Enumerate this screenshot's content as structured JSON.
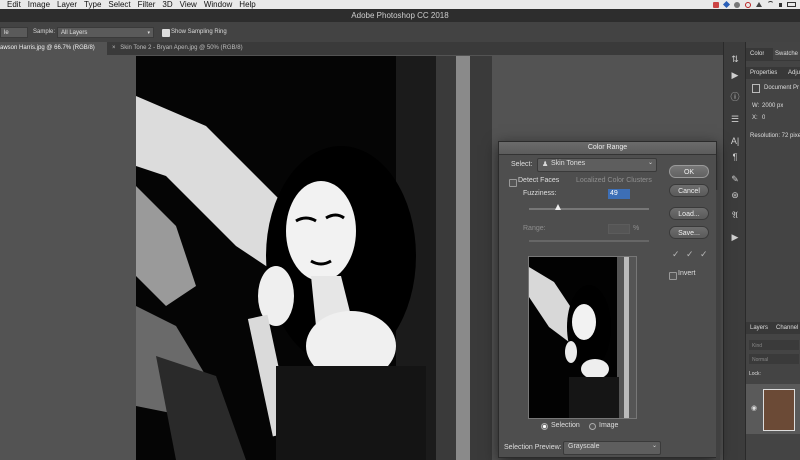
{
  "menubar": {
    "items": [
      "Edit",
      "Image",
      "Layer",
      "Type",
      "Select",
      "Filter",
      "3D",
      "View",
      "Window",
      "Help"
    ]
  },
  "titlebar": {
    "title": "Adobe Photoshop CC 2018"
  },
  "options": {
    "mode_value": "le",
    "sample_label": "Sample:",
    "sample_value": "All Layers",
    "sampling_ring_label": "Show Sampling Ring"
  },
  "tabs": [
    {
      "label": "awson Harris.jpg @ 66.7% (RGB/8)",
      "active": true
    },
    {
      "label": "Skin Tone 2 - Bryan Apen.jpg @ 50% (RGB/8)",
      "active": false
    }
  ],
  "right_panels": {
    "top_tabs": [
      "Color",
      "Swatche"
    ],
    "properties_tabs": [
      "Properties",
      "Adju"
    ],
    "doc_label": "Document Pr",
    "width_label": "W:",
    "width_value": "2000 px",
    "x_label": "X:",
    "x_value": "0",
    "resolution": "Resolution: 72 pixel",
    "layers_tabs": [
      "Layers",
      "Channel"
    ],
    "kind_label": "Kind",
    "blend_mode": "Normal",
    "lock_label": "Lock:"
  },
  "dialog": {
    "title": "Color Range",
    "select_label": "Select:",
    "select_value": "Skin Tones",
    "detect_faces_label": "Detect Faces",
    "localized_label": "Localized Color Clusters",
    "fuzziness_label": "Fuzziness:",
    "fuzziness_value": "49",
    "fuzziness_level": 0.245,
    "range_label": "Range:",
    "range_unit": "%",
    "buttons": {
      "ok": "OK",
      "cancel": "Cancel",
      "load": "Load...",
      "save": "Save..."
    },
    "invert_label": "Invert",
    "selection_radio": "Selection",
    "image_radio": "Image",
    "preview_label": "Selection Preview:",
    "preview_value": "Grayscale"
  },
  "colors": {
    "menubar_bg": "#e9e9e9",
    "title_bg": "#2d2d2d",
    "workspace": "#535353",
    "highlight": "#3d6fb6"
  }
}
